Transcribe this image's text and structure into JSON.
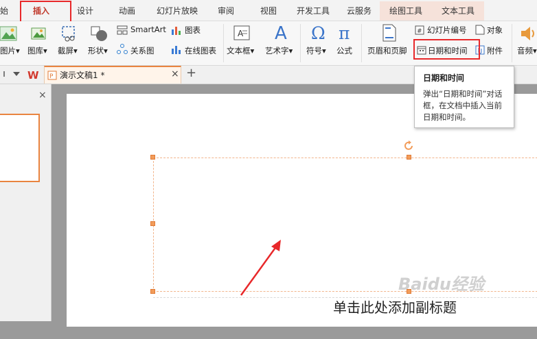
{
  "tabs": {
    "start_partial": "始",
    "insert": "插入",
    "design": "设计",
    "animation": "动画",
    "slideshow": "幻灯片放映",
    "review": "审阅",
    "view": "视图",
    "developer": "开发工具",
    "cloud": "云服务",
    "drawing_tools": "绘图工具",
    "text_tools": "文本工具"
  },
  "ribbon": {
    "picture": "图片",
    "gallery": "图库",
    "screenshot": "截屏",
    "shapes": "形状",
    "smartart": "SmartArt",
    "chart": "图表",
    "relation": "关系图",
    "online_chart": "在线图表",
    "textbox": "文本框",
    "wordart": "艺术字",
    "symbol": "符号",
    "formula": "公式",
    "header_footer": "页眉和页脚",
    "slide_number": "幻灯片编号",
    "object": "对象",
    "date_time": "日期和时间",
    "attachment": "附件",
    "audio": "音频",
    "dropdown_arrow": "▾"
  },
  "doc": {
    "tab_title": "演示文稿1 *",
    "close": "×",
    "add": "+"
  },
  "tooltip": {
    "title": "日期和时间",
    "body": "弹出“日期和时间”对话框，在文档中插入当前日期和时间。"
  },
  "slide": {
    "subtitle_placeholder": "单击此处添加副标题"
  },
  "watermark": "Baidu经验",
  "colors": {
    "accent": "#e8282a",
    "selection_orange": "#f29c5a",
    "context_tab_bg": "#f6e2da"
  }
}
